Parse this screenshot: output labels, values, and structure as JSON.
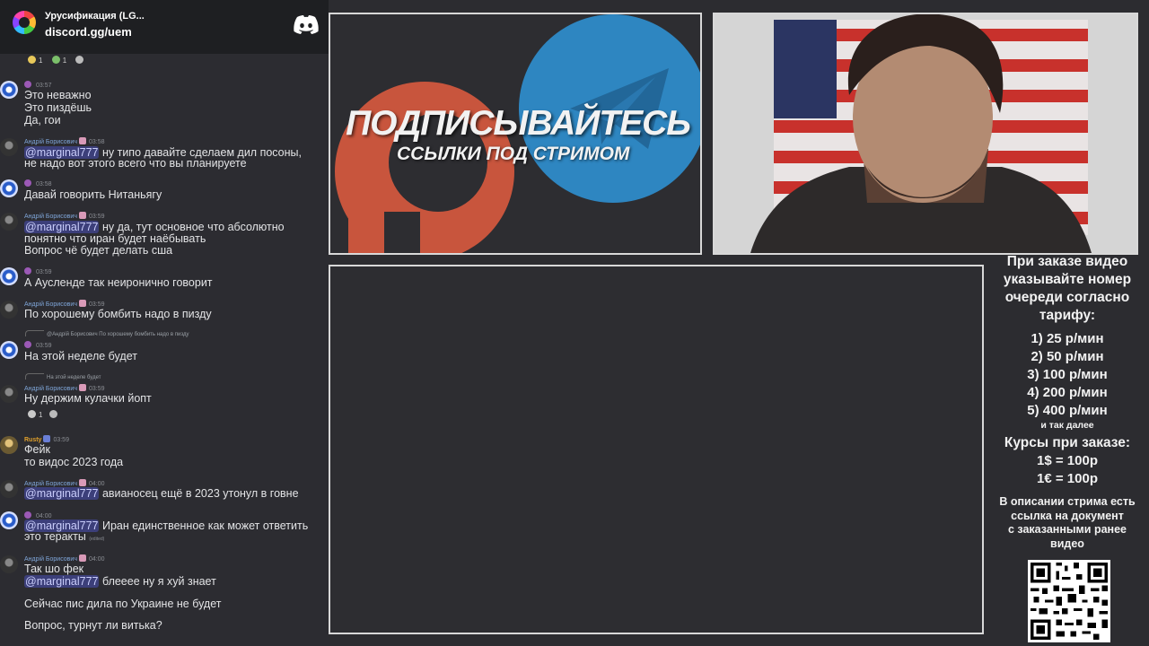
{
  "server": {
    "name": "Урусификация (LG...",
    "invite": "discord.gg/uem",
    "icon": "discord-icon"
  },
  "chat": {
    "top_reactions": [
      "1",
      "1"
    ],
    "messages": [
      {
        "author": "",
        "time": "03:57",
        "lines": [
          "Это неважно",
          "Это пиздёшь",
          "Да, гои"
        ]
      },
      {
        "author": "Андрій Борисович",
        "time": "03:58",
        "mention": "@marginal777",
        "lines": [
          "ну типо давайте сделаем дил посоны,",
          "не надо вот этого всего что вы планируете"
        ]
      },
      {
        "author": "",
        "time": "03:58",
        "lines": [
          "Давай говорить Нитаньягу"
        ]
      },
      {
        "author": "Андрій Борисович",
        "time": "03:59",
        "mention": "@marginal777",
        "lines": [
          "ну да, тут основное что абсолютно",
          "понятно что иран будет наёбывать",
          "Вопрос чё будет делать сша"
        ]
      },
      {
        "author": "",
        "time": "03:59",
        "lines": [
          "А Аусленде так неиронично говорит"
        ]
      },
      {
        "author": "Андрій Борисович",
        "time": "03:59",
        "lines": [
          "По хорошему бомбить надо в пизду"
        ]
      },
      {
        "reply_to": "@Андрій Борисович По хорошему бомбить надо в пизду",
        "author": "",
        "time": "03:59",
        "lines": [
          "На этой неделе будет"
        ]
      },
      {
        "reply_to": "На этой неделе будет",
        "author": "Андрій Борисович",
        "time": "03:59",
        "lines": [
          "Ну держим кулачки йопт"
        ],
        "reactions": [
          "1"
        ]
      },
      {
        "author": "Rusty",
        "time": "03:59",
        "lines": [
          "Фейк",
          "то видос 2023 года"
        ]
      },
      {
        "author": "Андрій Борисович",
        "time": "04:00",
        "mention": "@marginal777",
        "lines": [
          "авианосец ещё в 2023 утонул в говне"
        ]
      },
      {
        "author": "",
        "time": "04:00",
        "mention": "@marginal777",
        "lines": [
          "Иран единственное как может ответить",
          "это теракты"
        ],
        "edited": "(edited)"
      },
      {
        "author": "Андрій Борисович",
        "time": "04:00",
        "mention": "@marginal777",
        "lines": [
          "Так шо фек",
          "блееее ну я хуй знает",
          "Сейчас пис дила по Украине не будет",
          "Вопрос, турнут ли витька?"
        ]
      }
    ]
  },
  "promo": {
    "headline": "ПОДПИСЫВАЙТЕСЬ",
    "subline": "ССЫЛКИ ПОД СТРИМОМ",
    "colors": {
      "telegram": "#2e86c1",
      "patreon": "#c8553d"
    }
  },
  "info": {
    "heading": [
      "При заказе видео",
      "указывайте номер",
      "очереди согласно",
      "тарифу:"
    ],
    "tariffs": [
      "1) 25 р/мин",
      "2) 50 р/мин",
      "3) 100 р/мин",
      "4) 200 р/мин",
      "5) 400 р/мин"
    ],
    "etc": "и так далее",
    "rates_title": "Курсы при заказе:",
    "rates": [
      "1$ = 100р",
      "1€ = 100р"
    ],
    "doc_note": [
      "В описании стрима есть",
      "ссылка на документ",
      "с заказанными ранее",
      "видео"
    ]
  }
}
